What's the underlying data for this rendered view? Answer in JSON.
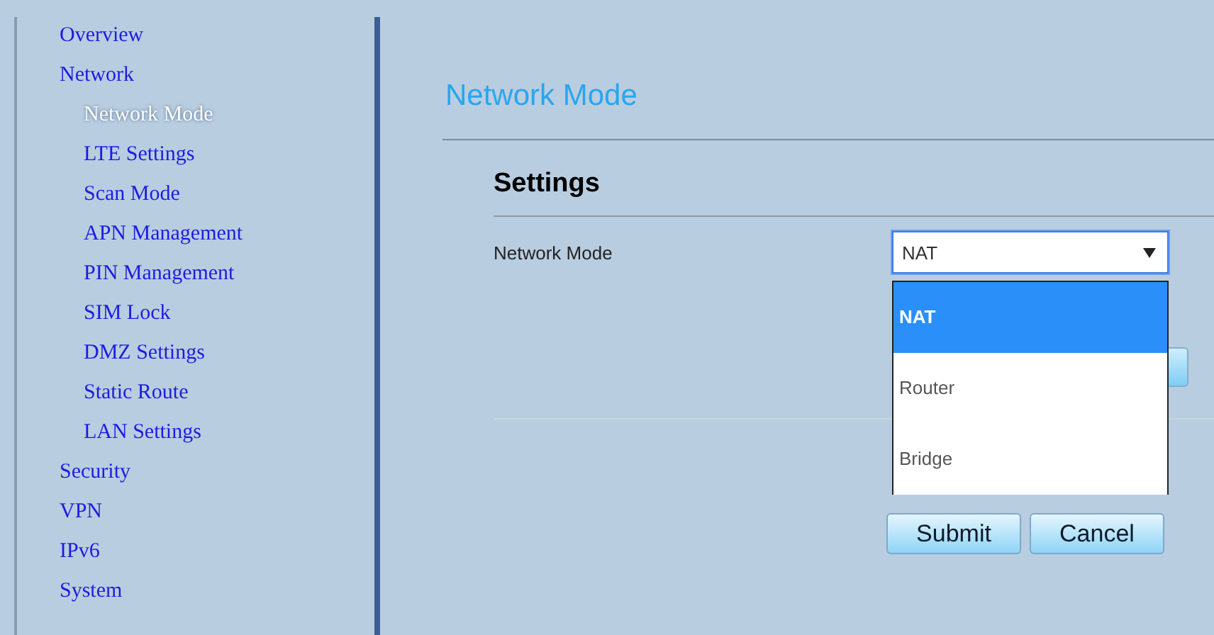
{
  "sidebar": {
    "items": [
      {
        "label": "Overview",
        "selected": false
      },
      {
        "label": "Network",
        "selected": false,
        "children": [
          {
            "label": "Network Mode",
            "selected": true
          },
          {
            "label": "LTE Settings",
            "selected": false
          },
          {
            "label": "Scan Mode",
            "selected": false
          },
          {
            "label": "APN Management",
            "selected": false
          },
          {
            "label": "PIN Management",
            "selected": false
          },
          {
            "label": "SIM Lock",
            "selected": false
          },
          {
            "label": "DMZ Settings",
            "selected": false
          },
          {
            "label": "Static Route",
            "selected": false
          },
          {
            "label": "LAN Settings",
            "selected": false
          }
        ]
      },
      {
        "label": "Security",
        "selected": false
      },
      {
        "label": "VPN",
        "selected": false
      },
      {
        "label": "IPv6",
        "selected": false
      },
      {
        "label": "System",
        "selected": false
      }
    ]
  },
  "page": {
    "title": "Network Mode",
    "section": "Settings",
    "field": {
      "label": "Network Mode",
      "value": "NAT",
      "expanded": true,
      "options": [
        {
          "label": "NAT",
          "selected": true
        },
        {
          "label": "Router",
          "selected": false
        },
        {
          "label": "Bridge",
          "selected": false
        }
      ]
    },
    "buttons": [
      "Submit",
      "Cancel"
    ]
  }
}
